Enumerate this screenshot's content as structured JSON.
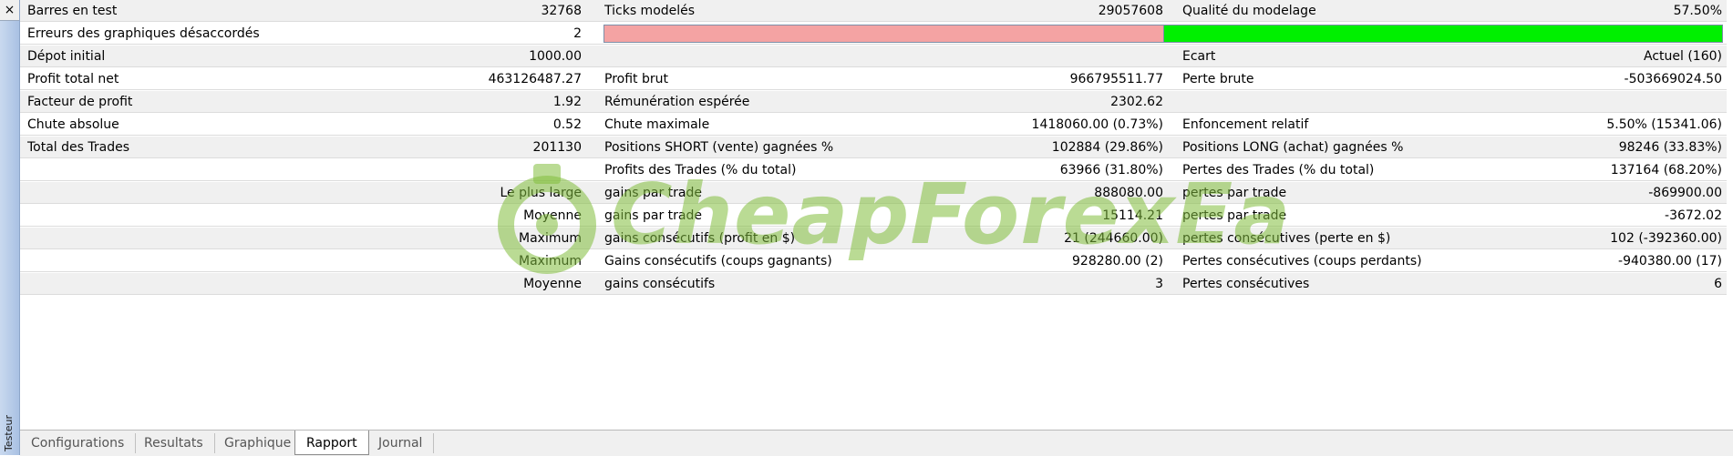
{
  "sidebar": {
    "close_glyph": "×",
    "label": "Testeur"
  },
  "report": {
    "rows": [
      {
        "l1": "Barres en test",
        "v1": "32768",
        "l2": "Ticks modelés",
        "v2": "29057608",
        "l3": "Qualité du modelage",
        "v3": "57.50%"
      },
      {
        "l1": "Erreurs des graphiques désaccordés",
        "v1": "2",
        "l2": "",
        "v2": "",
        "l3": "",
        "v3": ""
      },
      {
        "l1": "Dépot initial",
        "v1": "1000.00",
        "l2": "",
        "v2": "",
        "l3": "Ecart",
        "v3": "Actuel (160)"
      },
      {
        "l1": "Profit total net",
        "v1": "463126487.27",
        "l2": "Profit brut",
        "v2": "966795511.77",
        "l3": "Perte brute",
        "v3": "-503669024.50"
      },
      {
        "l1": "Facteur de profit",
        "v1": "1.92",
        "l2": "Rémunération espérée",
        "v2": "2302.62",
        "l3": "",
        "v3": ""
      },
      {
        "l1": "Chute absolue",
        "v1": "0.52",
        "l2": "Chute maximale",
        "v2": "1418060.00 (0.73%)",
        "l3": "Enfoncement relatif",
        "v3": "5.50% (15341.06)"
      },
      {
        "l1": "Total des Trades",
        "v1": "201130",
        "l2": "Positions SHORT (vente) gagnées %",
        "v2": "102884 (29.86%)",
        "l3": "Positions LONG (achat) gagnées %",
        "v3": "98246 (33.83%)"
      },
      {
        "l1": "",
        "v1": "",
        "l2": "Profits des Trades (% du total)",
        "v2": "63966 (31.80%)",
        "l3": "Pertes des Trades (% du total)",
        "v3": "137164 (68.20%)"
      },
      {
        "l1": "",
        "v1": "Le plus large",
        "l2": "gains par trade",
        "v2": "888080.00",
        "l3": "pertes par trade",
        "v3": "-869900.00"
      },
      {
        "l1": "",
        "v1": "Moyenne",
        "l2": "gains par trade",
        "v2": "15114.21",
        "l3": "pertes par trade",
        "v3": "-3672.02"
      },
      {
        "l1": "",
        "v1": "Maximum",
        "l2": "gains consécutifs (profit en $)",
        "v2": "21 (244660.00)",
        "l3": "pertes consécutives (perte en $)",
        "v3": "102 (-392360.00)"
      },
      {
        "l1": "",
        "v1": "Maximum",
        "l2": "Gains consécutifs (coups gagnants)",
        "v2": "928280.00 (2)",
        "l3": "Pertes consécutives (coups perdants)",
        "v3": "-940380.00 (17)"
      },
      {
        "l1": "",
        "v1": "Moyenne",
        "l2": "gains consécutifs",
        "v2": "3",
        "l3": "Pertes consécutives",
        "v3": "6"
      }
    ],
    "modeling_quality_pct": 57.5,
    "colors": {
      "bar_bad": "#f4a3a3",
      "bar_good": "#00f000"
    }
  },
  "watermark": {
    "text": "CheapForexEa"
  },
  "tabs": [
    "Configurations",
    "Resultats",
    "Graphique",
    "Rapport",
    "Journal"
  ],
  "active_tab": "Rapport"
}
